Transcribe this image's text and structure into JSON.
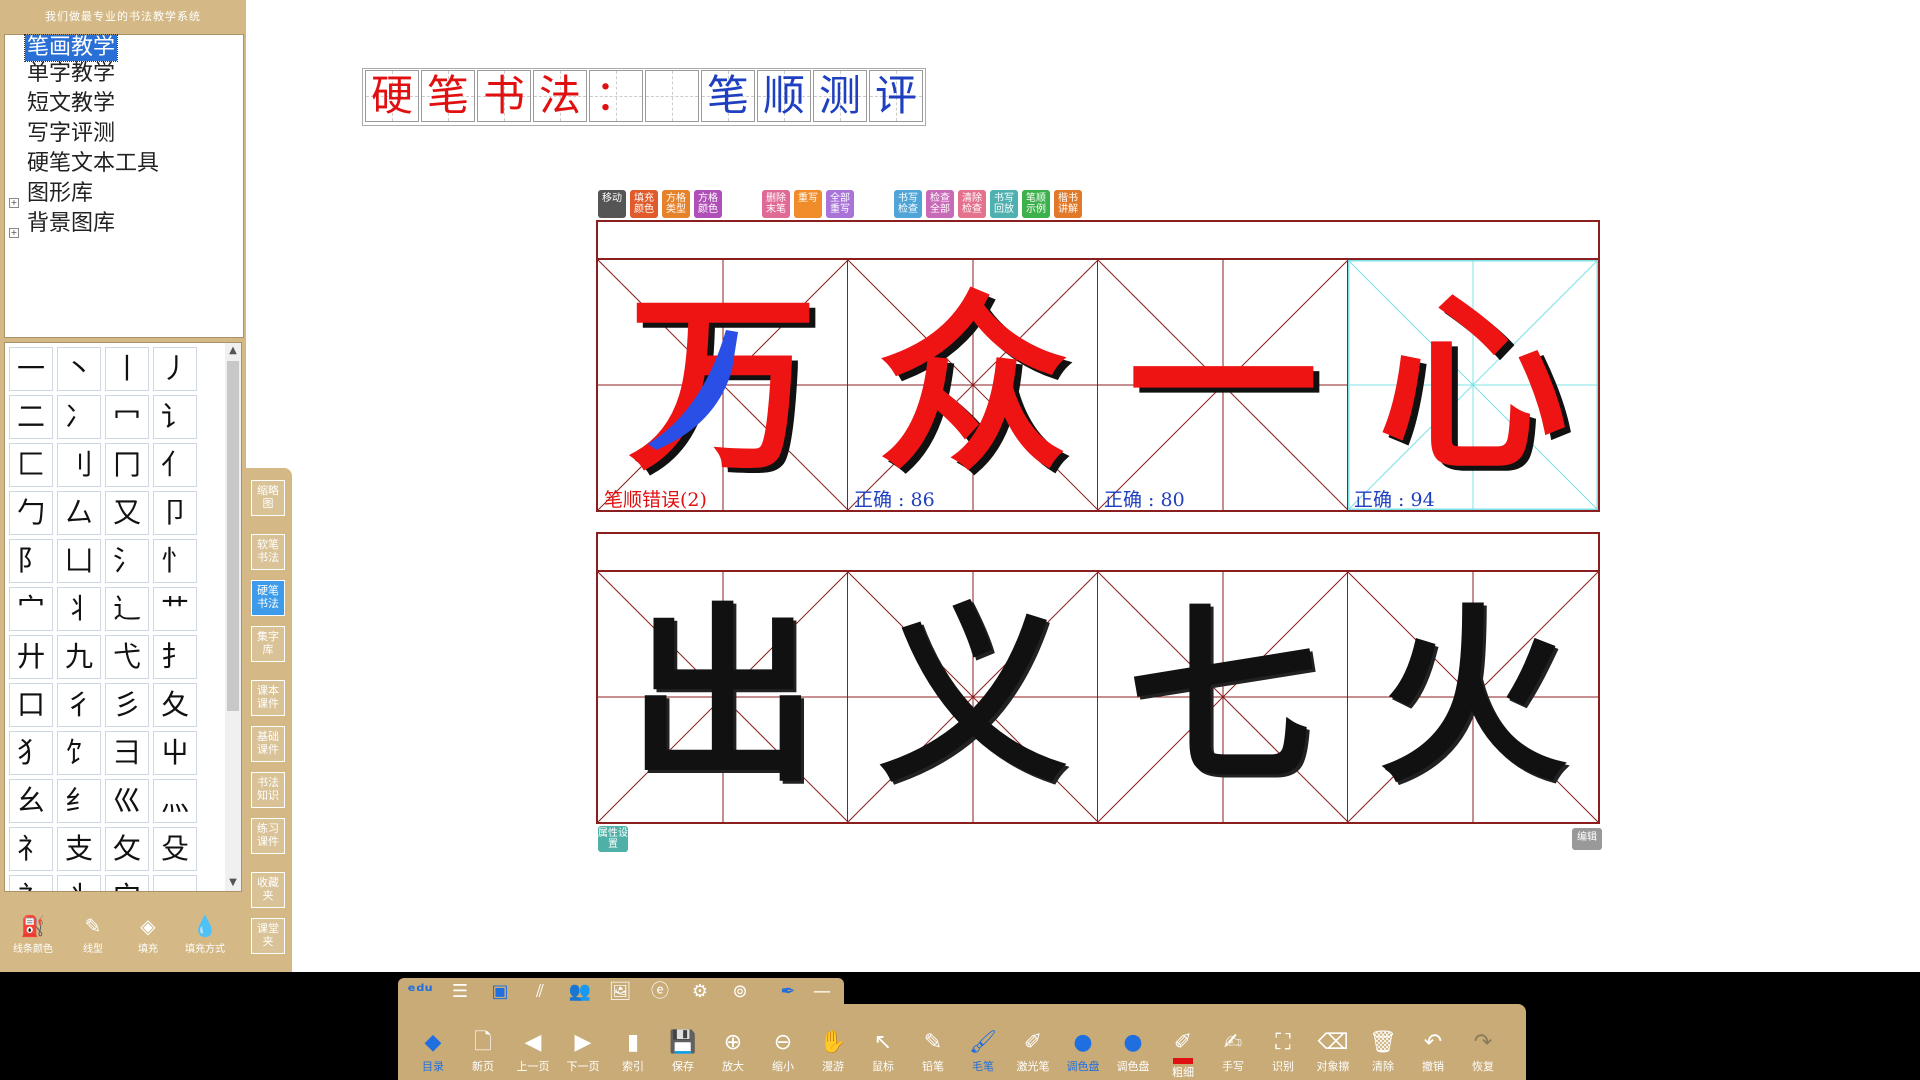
{
  "app": {
    "title": "我们做最专业的书法教学系统"
  },
  "tree": {
    "items": [
      {
        "label": "笔画教学",
        "selected": true
      },
      {
        "label": "单字教学"
      },
      {
        "label": "短文教学"
      },
      {
        "label": "写字评测"
      },
      {
        "label": "硬笔文本工具"
      },
      {
        "label": "图形库",
        "expandable": true
      },
      {
        "label": "背景图库",
        "expandable": true
      }
    ]
  },
  "strokes": [
    "一",
    "丶",
    "丨",
    "丿",
    "二",
    "冫",
    "冖",
    "讠",
    "匚",
    "刂",
    "冂",
    "亻",
    "勹",
    "厶",
    "又",
    "卩",
    "阝",
    "凵",
    "氵",
    "忄",
    "宀",
    "丬",
    "辶",
    "艹",
    "廾",
    "九",
    "弋",
    "扌",
    "口",
    "彳",
    "彡",
    "夂",
    "犭",
    "饣",
    "彐",
    "屮",
    "幺",
    "纟",
    "巛",
    "灬",
    "礻",
    "支",
    "攵",
    "殳",
    "衤",
    "丬",
    "宀",
    "一"
  ],
  "left_tools": [
    {
      "label": "线条颜色",
      "icon": "paint-bucket-icon"
    },
    {
      "label": "线型",
      "icon": "line-type-icon"
    },
    {
      "label": "填充",
      "icon": "fill-icon"
    },
    {
      "label": "填充方式",
      "icon": "fill-mode-icon"
    }
  ],
  "side_tabs": [
    {
      "label": "缩略图"
    },
    {
      "label": "软笔书法"
    },
    {
      "label": "硬笔书法",
      "active": true
    },
    {
      "label": "集字库"
    },
    {
      "label": "课本课件"
    },
    {
      "label": "基础课件"
    },
    {
      "label": "书法知识"
    },
    {
      "label": "练习课件"
    },
    {
      "label": "收藏夹"
    },
    {
      "label": "课堂夹"
    }
  ],
  "page_title": {
    "chars": [
      "硬",
      "笔",
      "书",
      "法",
      "：",
      "",
      "笔",
      "顺",
      "测",
      "评"
    ],
    "colors": [
      "#e01010",
      "#e01010",
      "#e01010",
      "#e01010",
      "#e01010",
      "#e01010",
      "#1e3fbf",
      "#1e3fbf",
      "#1e3fbf",
      "#1e3fbf"
    ]
  },
  "mini_toolbar": [
    {
      "label": "移动",
      "color": "#555555"
    },
    {
      "label": "填充颜色",
      "color": "#e05a2a"
    },
    {
      "label": "方格类型",
      "color": "#e6822a"
    },
    {
      "label": "方格颜色",
      "color": "#b04fb7"
    },
    {
      "label": "删除末笔",
      "color": "#e06a96"
    },
    {
      "label": "重写",
      "color": "#f08c2a"
    },
    {
      "label": "全部重写",
      "color": "#a874d8"
    },
    {
      "label": "书写检查",
      "color": "#4fa5d8"
    },
    {
      "label": "检查全部",
      "color": "#c96ab8"
    },
    {
      "label": "清除检查",
      "color": "#e4728e"
    },
    {
      "label": "书写回放",
      "color": "#4fb0b0"
    },
    {
      "label": "笔顺示例",
      "color": "#3cb04a"
    },
    {
      "label": "楷书讲解",
      "color": "#e07a2a"
    }
  ],
  "board1": {
    "cells": [
      {
        "char": "万",
        "score": "笔顺错误(2)",
        "score_color": "#e01010"
      },
      {
        "char": "众",
        "score": "正确 : 86",
        "score_color": "#1e3fbf"
      },
      {
        "char": "一",
        "score": "正确 : 80",
        "score_color": "#1e3fbf"
      },
      {
        "char": "心",
        "score": "正确 : 94",
        "score_color": "#1e3fbf",
        "highlight": true
      }
    ]
  },
  "board2": {
    "cells": [
      {
        "char": "出"
      },
      {
        "char": "义"
      },
      {
        "char": "七"
      },
      {
        "char": "火"
      }
    ]
  },
  "board_buttons": {
    "property": "属性设置",
    "edit": "编辑"
  },
  "bottom_top_tools": [
    {
      "label": "",
      "icon": "logo-icon"
    },
    {
      "label": "菜单",
      "icon": "menu-icon"
    },
    {
      "label": "",
      "icon": "board-icon",
      "active": true
    },
    {
      "label": "书法仪",
      "icon": "calligraphy-icon"
    },
    {
      "label": "学生",
      "icon": "students-icon"
    },
    {
      "label": "课件",
      "icon": "courseware-icon"
    },
    {
      "label": "网络",
      "icon": "ie-icon"
    },
    {
      "label": "工具",
      "icon": "gear-icon"
    },
    {
      "label": "纵向",
      "icon": "vertical-icon"
    },
    {
      "label": "",
      "icon": "pin-icon"
    },
    {
      "label": "",
      "icon": "minimize-icon"
    }
  ],
  "bottom_main_tools": [
    {
      "label": "目录",
      "icon": "layers-icon",
      "active": true
    },
    {
      "label": "新页",
      "icon": "new-page-icon"
    },
    {
      "label": "上一页",
      "icon": "prev-icon"
    },
    {
      "label": "下一页",
      "icon": "next-icon"
    },
    {
      "label": "索引",
      "icon": "index-icon"
    },
    {
      "label": "保存",
      "icon": "save-icon"
    },
    {
      "label": "放大",
      "icon": "zoom-in-icon"
    },
    {
      "label": "缩小",
      "icon": "zoom-out-icon"
    },
    {
      "label": "漫游",
      "icon": "hand-icon"
    },
    {
      "label": "鼠标",
      "icon": "cursor-icon"
    },
    {
      "label": "铅笔",
      "icon": "pencil-icon"
    },
    {
      "label": "毛笔",
      "icon": "brush-icon",
      "active": true
    },
    {
      "label": "激光笔",
      "icon": "laser-icon"
    },
    {
      "label": "调色盘",
      "icon": "palette-icon",
      "active": true
    },
    {
      "label": "调色盘",
      "icon": "palette2-icon"
    },
    {
      "label": "粗细",
      "icon": "thickness-icon"
    },
    {
      "label": "手写",
      "icon": "handwrite-icon"
    },
    {
      "label": "识别",
      "icon": "recognize-icon"
    },
    {
      "label": "对象擦",
      "icon": "eraser-icon"
    },
    {
      "label": "清除",
      "icon": "trash-icon"
    },
    {
      "label": "撤销",
      "icon": "undo-icon"
    },
    {
      "label": "恢复",
      "icon": "redo-icon"
    }
  ]
}
